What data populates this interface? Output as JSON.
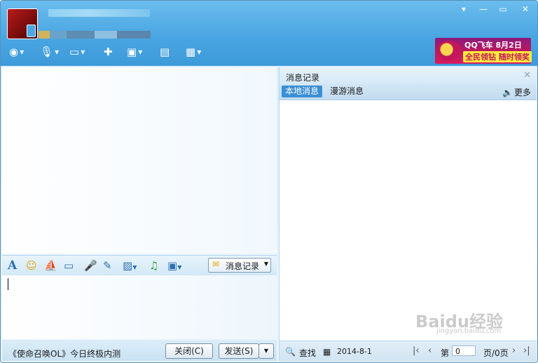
{
  "header": {
    "window_controls": {
      "menu": "▾",
      "minimize": "—",
      "maximize": "▭",
      "close": "✕"
    },
    "toolbar_icons": [
      "video-camera-icon",
      "microphone-icon",
      "send-file-icon",
      "add-discussion-icon",
      "remote-assist-icon",
      "screen-share-icon",
      "apps-icon"
    ],
    "ad": {
      "line1": "QQ飞车 8月2日",
      "line2": "全民领钻 随时领奖"
    }
  },
  "format_toolbar": {
    "icons": [
      "font-icon",
      "emoji-icon",
      "magic-expression-icon",
      "screenshot-icon",
      "voice-message-icon",
      "doodle-icon",
      "image-icon",
      "music-icon",
      "screen-capture-icon"
    ],
    "history_button": "消息记录"
  },
  "bottom_bar": {
    "status_text": "《使命召唤OL》今日终极内测",
    "close_button": "关闭(C)",
    "send_button": "发送(S)"
  },
  "history_panel": {
    "title": "消息记录",
    "close": "✕",
    "tabs": [
      "本地消息",
      "漫游消息"
    ],
    "more": "更多",
    "footer": {
      "search_label": "查找",
      "date": "2014-8-1",
      "page_prefix": "第",
      "page_value": "0",
      "page_suffix": "页/0页"
    }
  },
  "watermark": {
    "text": "Baidu经验",
    "sub": "jingyan.baidu.com"
  }
}
